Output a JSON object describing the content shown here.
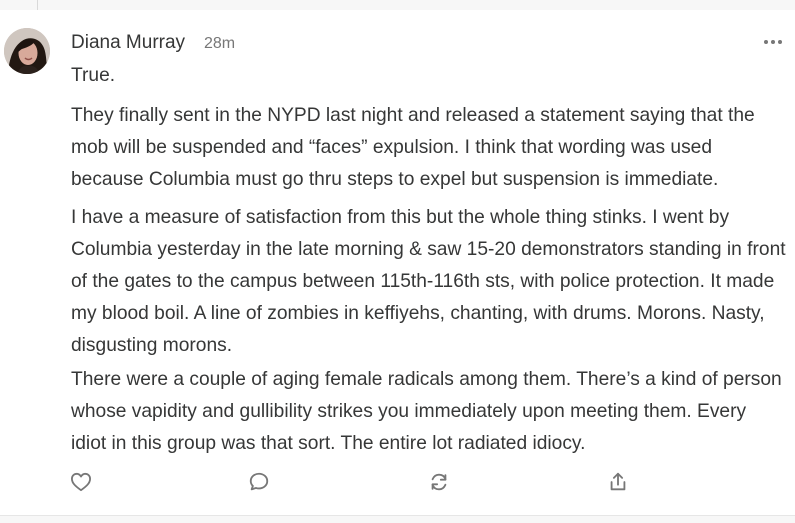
{
  "comment": {
    "author": "Diana Murray",
    "timestamp": "28m",
    "paragraphs": [
      "True.",
      "They finally sent in the NYPD last night and released a statement saying that the mob will be suspended and “faces” expulsion. I think that wording was used because Columbia must go thru steps to expel but suspension is immediate.",
      "I have a measure of satisfaction from this but the whole thing stinks. I went by Columbia yesterday in the late morning & saw 15-20 demonstrators standing in front of the gates to the campus between 115th-116th sts, with police protection. It made my blood boil. A line of zombies in keffiyehs, chanting, with drums. Morons. Nasty, disgusting morons.",
      "There were a couple of aging female radicals among them. There’s a kind of person whose vapidity and gullibility strikes you immediately upon meeting them. Every idiot in this group was that sort. The entire lot radiated idiocy."
    ]
  },
  "icons": {
    "more": "more-horizontal-icon",
    "like": "heart-icon",
    "reply": "comment-bubble-icon",
    "restack": "restack-icon",
    "share": "share-icon"
  },
  "colors": {
    "text": "#363737",
    "muted": "#777777",
    "background": "#ffffff"
  }
}
